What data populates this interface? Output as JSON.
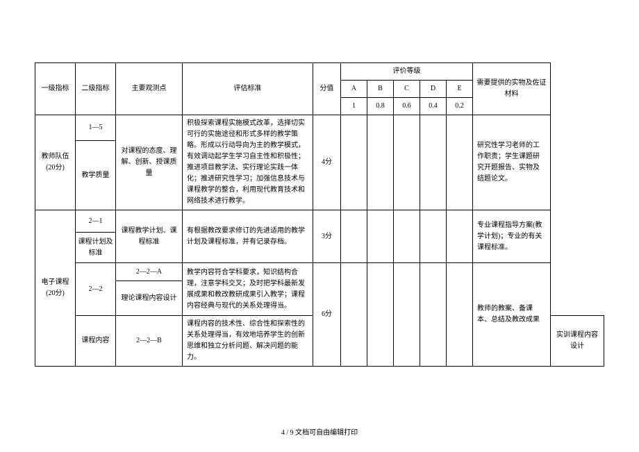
{
  "header": {
    "col1": "一级指标",
    "col2": "二级指标",
    "col3": "主要观测点",
    "col4": "评估标准",
    "col5": "分值",
    "rating_header": "评价等级",
    "col7": "需要提供的实物及佐证材料",
    "grades": {
      "A": "A",
      "B": "B",
      "C": "C",
      "D": "D",
      "E": "E"
    },
    "weights": {
      "A": "1",
      "B": "0.8",
      "C": "0.6",
      "D": "0.4",
      "E": "0.2"
    }
  },
  "row1": {
    "level1_name": "教师队伍",
    "level1_score": "(20分)",
    "level2_code": "1—5",
    "level2_name": "教学质量",
    "observe": "对课程的态度、理解、创新、授课质量",
    "standard": "积极探索课程实施模式改革，选择切实可行的实施途径和形式多样的教学策略。形成以行动导向为主的教学模式，有效调动起学生学习自主性和积极性；推进项目教学法、实行理论实践一体化；推进研究性学习；加强信息技术与课程教学的整合，利用现代教育技术和网络技术进行教学。",
    "score": "4分",
    "material": "研究性学习老师的工作职责；学生课题研究开题报告、实物及结题论文。"
  },
  "row2": {
    "level1_name": "电子课程",
    "level1_score": "(20分)",
    "level2_code": "2—1",
    "level2_name": "课程计划及标准",
    "observe": "课程教学计划、课程标准",
    "standard": "有根据教改要求修订的先进适用的教学计划及课程标准，并有记录存档。",
    "score": "3分",
    "material": "专业课程指导方案(教学计划)；专业的有关课程标准。"
  },
  "row3": {
    "level2_code": "2—2",
    "level2_name": "课程内容",
    "sub_a_code": "2—2—A",
    "sub_a_observe": "理论课程内容设计",
    "sub_a_standard": "教学内容符合学科要求，知识结构合理，注意学科交叉；及时把学科最新发展成果和教改教研成果引入教学；课程内容经典与现代的关系处理得当。",
    "sub_b_code": "2—2—B",
    "sub_b_observe": "实训课程内容设计",
    "sub_b_standard": "课程内容的技术性、综合性和探索性的关系处理得当，有效地培养学生的创新思维和独立分析问题、解决问题的能力。",
    "score": "6分",
    "material": "教师的教案、备课本、总结及教改成果"
  },
  "footer": "4 / 9 文档可自由编辑打印"
}
